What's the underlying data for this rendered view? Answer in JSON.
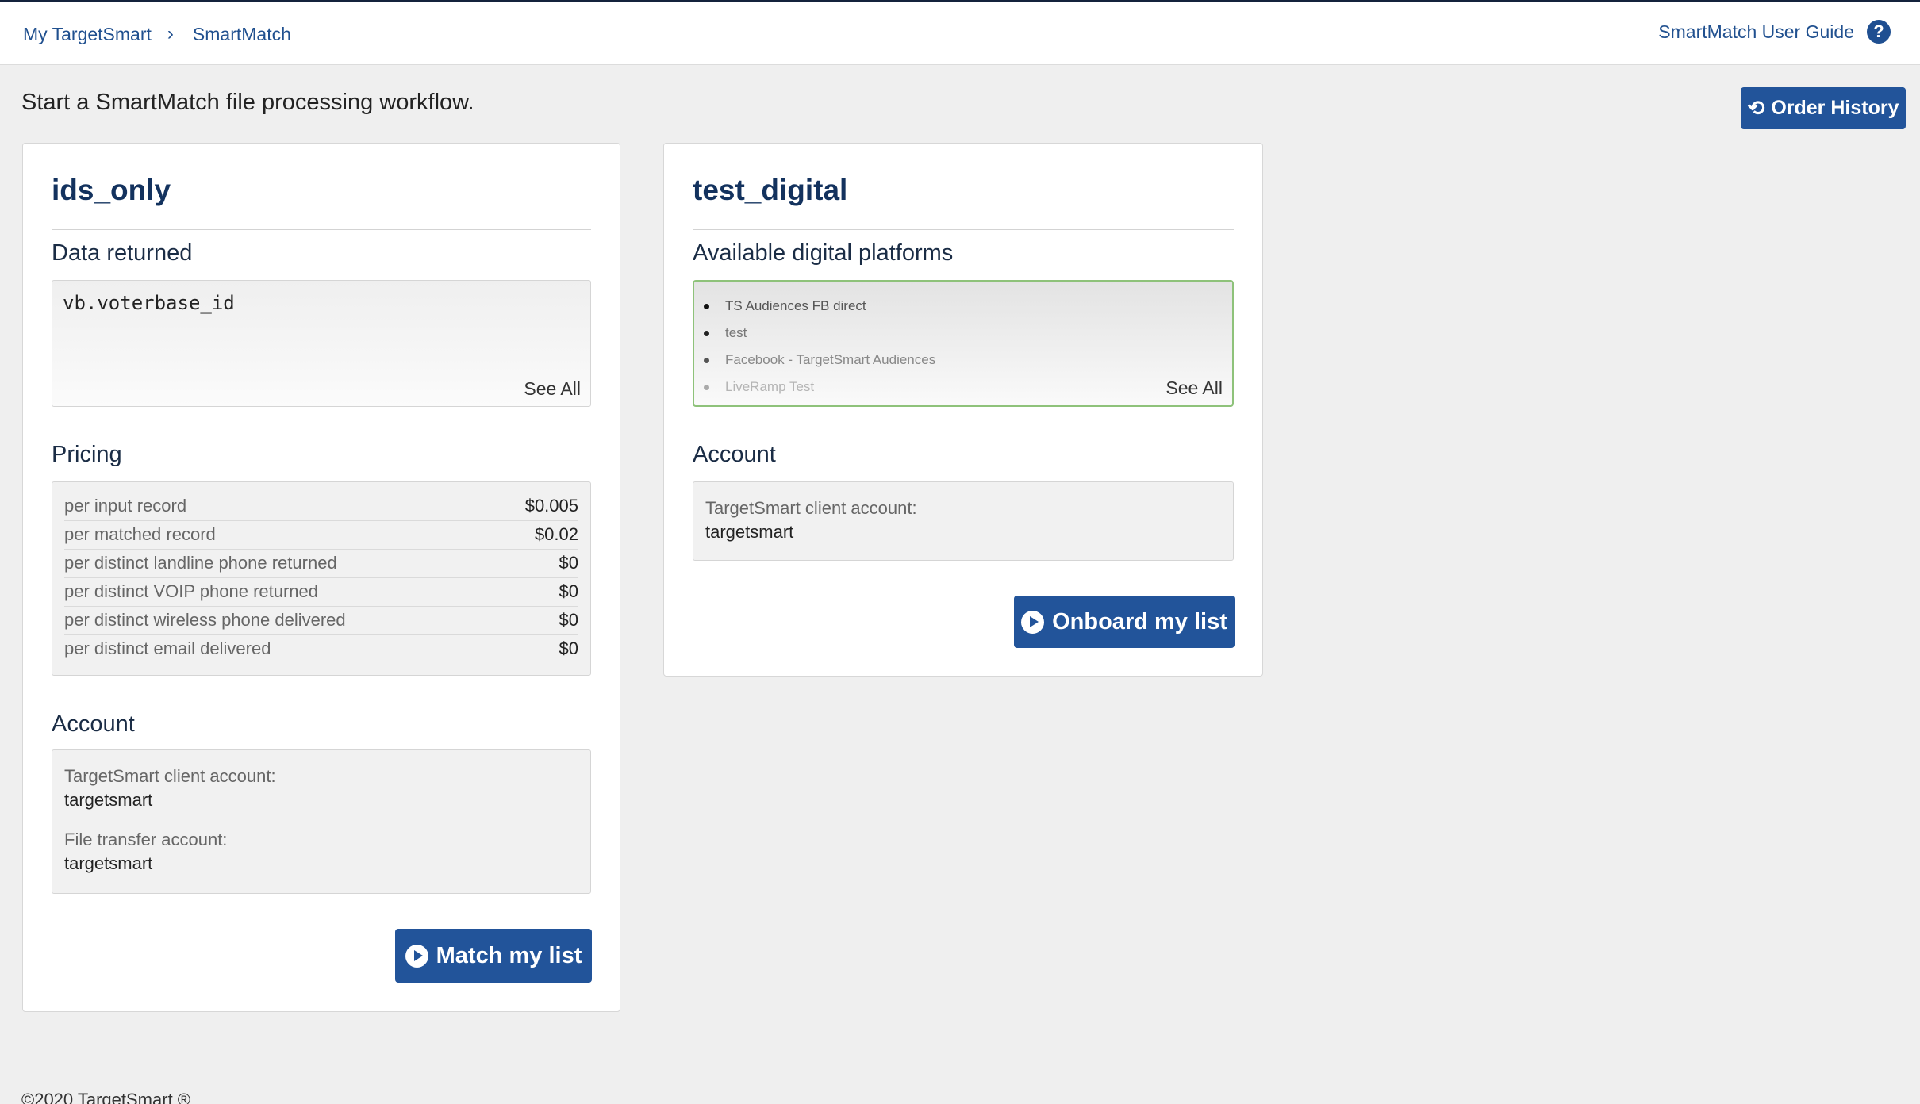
{
  "breadcrumb": {
    "items": [
      "My TargetSmart",
      "SmartMatch"
    ],
    "separator": "›"
  },
  "header": {
    "guide_label": "SmartMatch User Guide",
    "help_icon": "question-circle-icon"
  },
  "intro_text": "Start a SmartMatch file processing workflow.",
  "order_history": {
    "label": "Order History",
    "icon": "history-icon"
  },
  "cards": [
    {
      "title": "ids_only",
      "data_returned": {
        "label": "Data returned",
        "value": "vb.voterbase_id",
        "see_all": "See All"
      },
      "pricing": {
        "label": "Pricing",
        "rows": [
          {
            "label": "per input record",
            "value": "$0.005"
          },
          {
            "label": "per matched record",
            "value": "$0.02"
          },
          {
            "label": "per distinct landline phone returned",
            "value": "$0"
          },
          {
            "label": "per distinct VOIP phone returned",
            "value": "$0"
          },
          {
            "label": "per distinct wireless phone delivered",
            "value": "$0"
          },
          {
            "label": "per distinct email delivered",
            "value": "$0"
          }
        ]
      },
      "account": {
        "label": "Account",
        "client_label": "TargetSmart client account:",
        "client_value": "targetsmart",
        "transfer_label": "File transfer account:",
        "transfer_value": "targetsmart"
      },
      "button": {
        "label": "Match my list",
        "icon": "play-circle-icon"
      }
    },
    {
      "title": "test_digital",
      "platforms": {
        "label": "Available digital platforms",
        "items": [
          "TS Audiences FB direct",
          "test",
          "Facebook - TargetSmart Audiences",
          "LiveRamp Test"
        ],
        "see_all": "See All"
      },
      "account": {
        "label": "Account",
        "client_label": "TargetSmart client account:",
        "client_value": "targetsmart"
      },
      "button": {
        "label": "Onboard my list",
        "icon": "play-circle-icon"
      }
    }
  ],
  "colors": {
    "accent": "#22549a",
    "link": "#20508f",
    "title": "#13325e",
    "platform_border": "#8ec27a"
  },
  "footer": "©2020 TargetSmart ®"
}
